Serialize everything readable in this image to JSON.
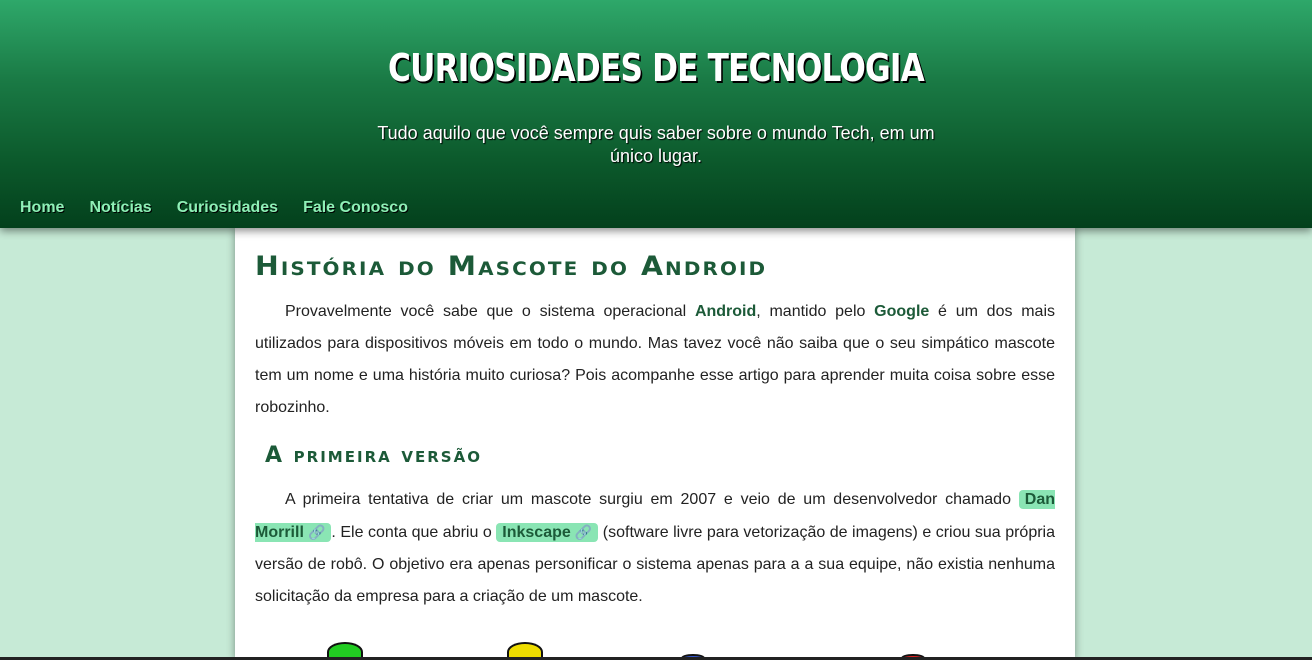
{
  "header": {
    "title": "CURIOSIDADES DE TECNOLOGIA",
    "subtitle": "Tudo aquilo que você sempre quis saber sobre o mundo Tech, em um único lugar."
  },
  "nav": {
    "items": [
      {
        "label": "Home"
      },
      {
        "label": "Notícias"
      },
      {
        "label": "Curiosidades"
      },
      {
        "label": "Fale Conosco"
      }
    ]
  },
  "article": {
    "title": "História do Mascote do Android",
    "intro": {
      "p1": "Provavelmente você sabe que o sistema operacional ",
      "android": "Android",
      "p2": ", mantido pelo ",
      "google": "Google",
      "p3": " é um dos mais utilizados para dispositivos móveis em todo o mundo. Mas tavez você não saiba que o seu simpático mascote tem um nome e uma história muito curiosa? Pois acompanhe esse artigo para aprender muita coisa sobre esse robozinho."
    },
    "section1": {
      "title": "A primeira versão",
      "p1": "A primeira tentativa de criar um mascote surgiu em 2007 e veio de um desenvolvedor chamado ",
      "link1": "Dan Morrill",
      "p2": ". Ele conta que abriu o ",
      "link2": "Inkscape",
      "p3": " (software livre para vetorização de imagens) e criou sua própria versão de robô. O objetivo era apenas personificar o sistema apenas para a a sua equipe, não existia nenhuma solicitação da empresa para a criação de um mascote."
    },
    "link_icon": "🔗"
  },
  "colors": {
    "header_gradient_top": "#2ea86a",
    "header_gradient_bottom": "#03401c",
    "page_background": "#c6ead6",
    "nav_link": "#8ff0b7",
    "heading": "#1c5a38",
    "link_highlight": "#8ae5b4"
  },
  "mascot_colors": [
    "#22cc22",
    "#eedd00",
    "#3355cc",
    "#dd2222"
  ]
}
